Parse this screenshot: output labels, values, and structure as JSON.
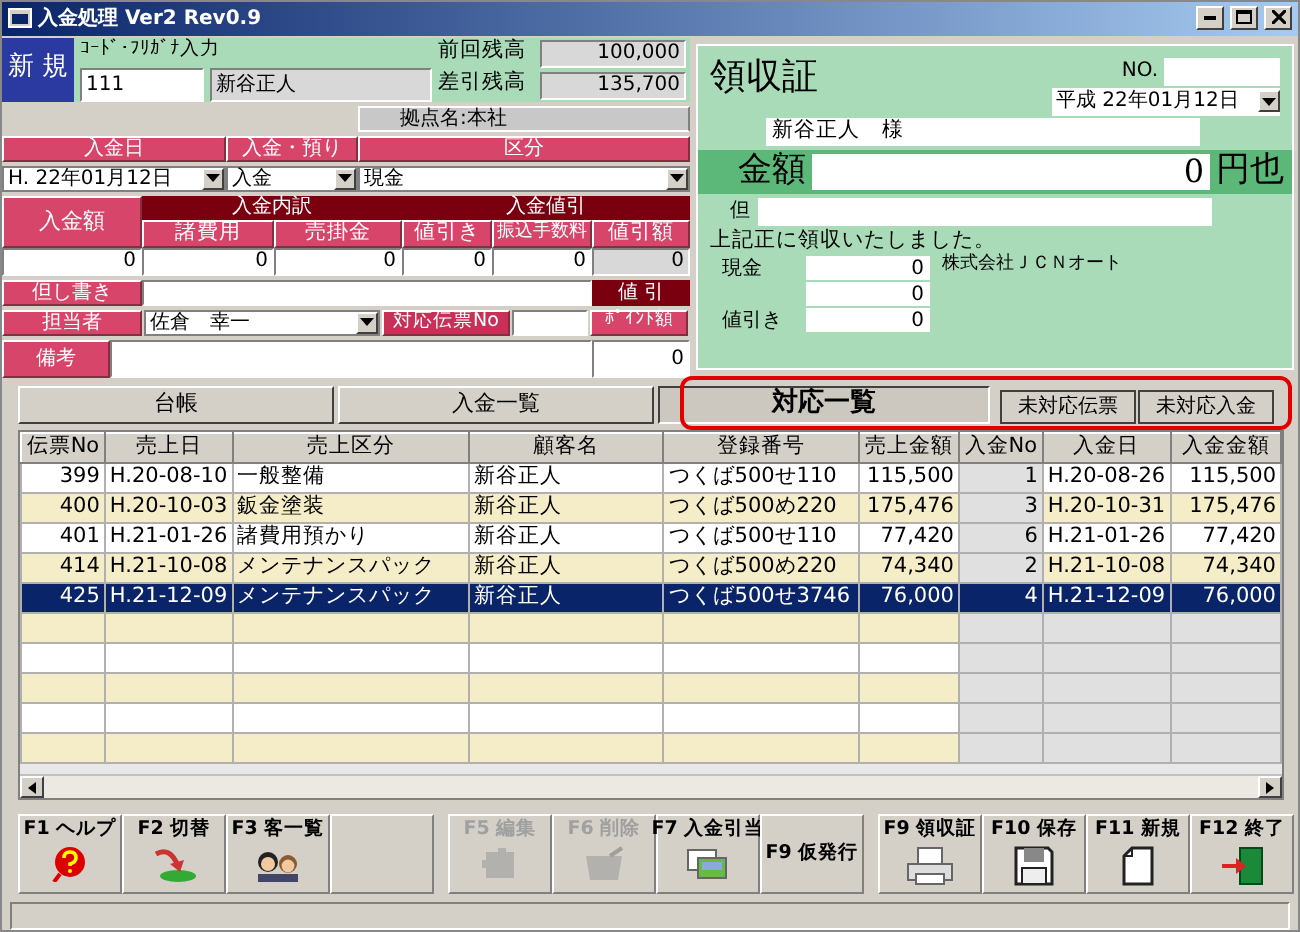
{
  "window": {
    "title": "入金処理 Ver2 Rev0.9"
  },
  "mode_badge": "新 規",
  "code_input": {
    "label": "ｺｰﾄﾞ･ﾌﾘｶﾞﾅ入力",
    "code": "111",
    "name": "新谷正人"
  },
  "balances": [
    {
      "label": "前回残高",
      "value": "100,000"
    },
    {
      "label": "差引残高",
      "value": "135,700"
    }
  ],
  "branch": "拠点名:本社",
  "entry": {
    "date": {
      "label": "入金日",
      "value": "H. 22年01月12日"
    },
    "type": {
      "label": "入金・預り",
      "value": "入金"
    },
    "category": {
      "label": "区分",
      "value": "現金"
    }
  },
  "amounts": {
    "amount_label": "入金額",
    "amount": "0",
    "breakdown_title": "入金内訳",
    "breakdown": [
      {
        "label": "諸費用",
        "value": "0"
      },
      {
        "label": "売掛金",
        "value": "0"
      }
    ],
    "discount_title": "入金値引",
    "discounts": [
      {
        "label": "値引き",
        "value": "0",
        "disabled": false
      },
      {
        "label": "振込手数料",
        "value": "0",
        "disabled": false
      },
      {
        "label": "値引額",
        "value": "0",
        "disabled": true
      }
    ]
  },
  "note": {
    "label": "但し書き"
  },
  "discount_button": "値 引",
  "staff": {
    "label": "担当者",
    "value": "佐倉　幸一"
  },
  "slip_no": {
    "label": "対応伝票No"
  },
  "points": {
    "label": "ﾎﾟｲﾝﾄ額",
    "value": "0"
  },
  "remarks": {
    "label": "備考"
  },
  "receipt": {
    "title": "領収証",
    "no_label": "NO.",
    "date": "平成 22年01月12日",
    "customer": "新谷正人　様",
    "amount_label": "金額",
    "amount": "0",
    "amount_suffix": "円也",
    "memo_label": "但",
    "statement": "上記正に領収いたしました。",
    "company": "株式会社ＪＣＮオート",
    "lines": [
      {
        "label": "現金",
        "value": "0"
      },
      {
        "value": "0"
      },
      {
        "label": "値引き",
        "value": "0"
      }
    ]
  },
  "tabs": [
    {
      "label": "台帳",
      "selected": false
    },
    {
      "label": "入金一覧",
      "selected": false
    },
    {
      "label": "対応一覧",
      "selected": true
    }
  ],
  "tab_buttons": [
    "未対応伝票",
    "未対応入金"
  ],
  "table": {
    "columns": [
      "伝票No",
      "売上日",
      "売上区分",
      "顧客名",
      "登録番号",
      "売上金額",
      "入金No",
      "入金日",
      "入金金額"
    ],
    "rows": [
      {
        "cells": [
          "399",
          "H.20-08-10",
          "一般整備",
          "新谷正人",
          "つくば500せ110",
          "115,500",
          "1",
          "H.20-08-26",
          "115,500"
        ],
        "selected": false
      },
      {
        "cells": [
          "400",
          "H.20-10-03",
          "鈑金塗装",
          "新谷正人",
          "つくば500め220",
          "175,476",
          "3",
          "H.20-10-31",
          "175,476"
        ],
        "selected": false
      },
      {
        "cells": [
          "401",
          "H.21-01-26",
          "諸費用預かり",
          "新谷正人",
          "つくば500せ110",
          "77,420",
          "6",
          "H.21-01-26",
          "77,420"
        ],
        "selected": false
      },
      {
        "cells": [
          "414",
          "H.21-10-08",
          "メンテナンスパック",
          "新谷正人",
          "つくば500め220",
          "74,340",
          "2",
          "H.21-10-08",
          "74,340"
        ],
        "selected": false
      },
      {
        "cells": [
          "425",
          "H.21-12-09",
          "メンテナンスパック",
          "新谷正人",
          "つくば500せ3746",
          "76,000",
          "4",
          "H.21-12-09",
          "76,000"
        ],
        "selected": true
      }
    ]
  },
  "function_keys": [
    [
      {
        "label": "F1 ヘルプ",
        "kind": "help",
        "disabled": false
      },
      {
        "label": "F2 切替",
        "kind": "switch",
        "disabled": false
      },
      {
        "label": "F3 客一覧",
        "kind": "people",
        "disabled": false
      },
      {
        "kind": "blank"
      }
    ],
    [
      {
        "label": "F5 編集",
        "kind": "edit",
        "disabled": true
      },
      {
        "label": "F6 削除",
        "kind": "delete",
        "disabled": true
      },
      {
        "label": "F7 入金引当",
        "kind": "photos",
        "disabled": false
      },
      {
        "label": "F9 仮発行",
        "kind": "text",
        "disabled": false
      }
    ],
    [
      {
        "label": "F9 領収証",
        "kind": "printer",
        "disabled": false
      },
      {
        "label": "F10 保存",
        "kind": "floppy",
        "disabled": false
      },
      {
        "label": "F11 新規",
        "kind": "page",
        "disabled": false
      },
      {
        "label": "F12 終了",
        "kind": "exit",
        "disabled": false
      }
    ]
  ]
}
